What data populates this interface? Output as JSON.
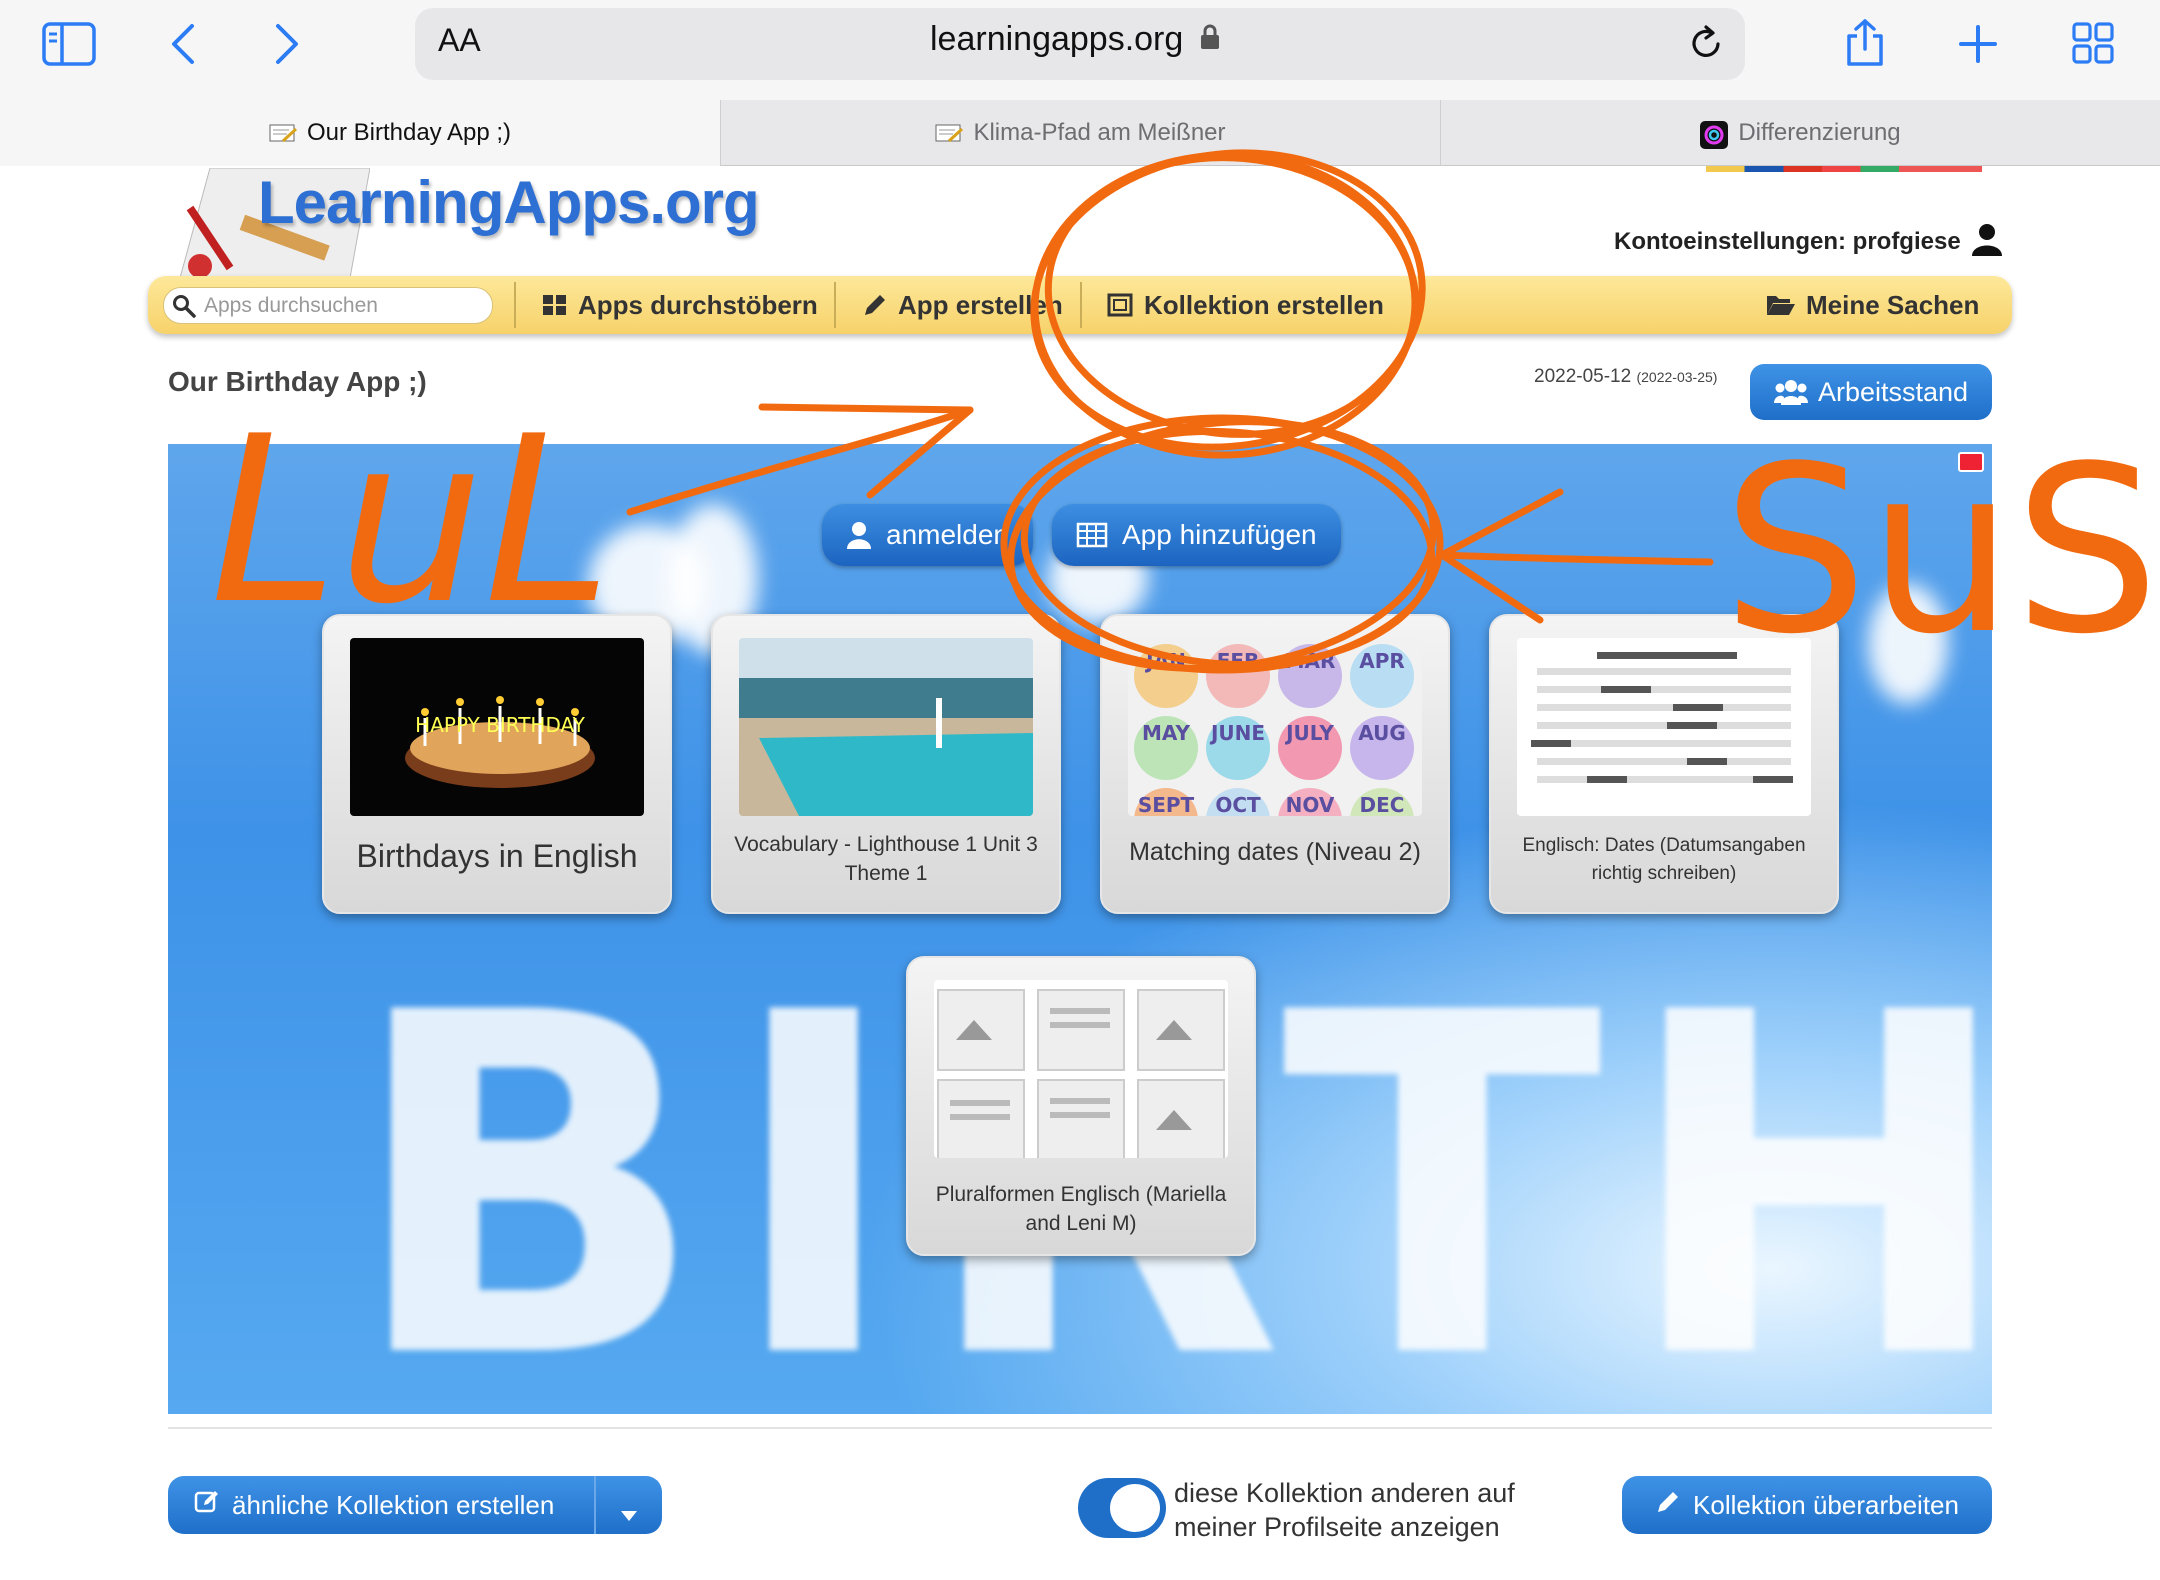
{
  "browser": {
    "reader_label": "AA",
    "url": "learningapps.org",
    "tabs": [
      {
        "label": "Our Birthday App ;)"
      },
      {
        "label": "Klima-Pfad am Meißner"
      },
      {
        "label": "Differenzierung"
      }
    ]
  },
  "site": {
    "logo": "LearningApps.org",
    "account": "Kontoeinstellungen: profgiese",
    "search_placeholder": "Apps durchsuchen",
    "nav": {
      "browse": "Apps durchstöbern",
      "create_app": "App erstellen",
      "create_collection": "Kollektion erstellen",
      "my_stuff": "Meine Sachen"
    }
  },
  "collection": {
    "title": "Our Birthday App ;)",
    "date": "2022-05-12",
    "date_created": "(2022-03-25)",
    "progress_button": "Arbeitsstand",
    "login_button": "anmelden",
    "add_app_button": "App hinzufügen",
    "cards": [
      {
        "caption": "Birthdays in English"
      },
      {
        "caption": "Vocabulary - Lighthouse 1 Unit 3 Theme 1"
      },
      {
        "caption": "Matching dates (Niveau 2)"
      },
      {
        "caption": "Englisch: Dates (Datumsangaben richtig schreiben)"
      },
      {
        "caption": "Pluralformen Englisch (Mariella and Leni M)"
      }
    ],
    "cake_text": "HAPPY BIRTHDAY",
    "months": [
      "JAN",
      "FEB",
      "MAR",
      "APR",
      "MAY",
      "JUNE",
      "JULY",
      "AUG",
      "SEPT",
      "OCT",
      "NOV",
      "DEC"
    ],
    "sky_text": "BIRTHDAY"
  },
  "annotations": {
    "left": "LuL",
    "right": "SuS",
    "color": "#f26a10"
  },
  "footer": {
    "similar_button": "ähnliche Kollektion erstellen",
    "toggle_label": "diese Kollektion anderen auf meiner Profilseite anzeigen",
    "toggle_on": true,
    "edit_button": "Kollektion überarbeiten"
  },
  "colors": {
    "accent": "#1f6fc9",
    "nav_yellow": "#f7d26a",
    "safari_blue": "#2c7cf6"
  }
}
